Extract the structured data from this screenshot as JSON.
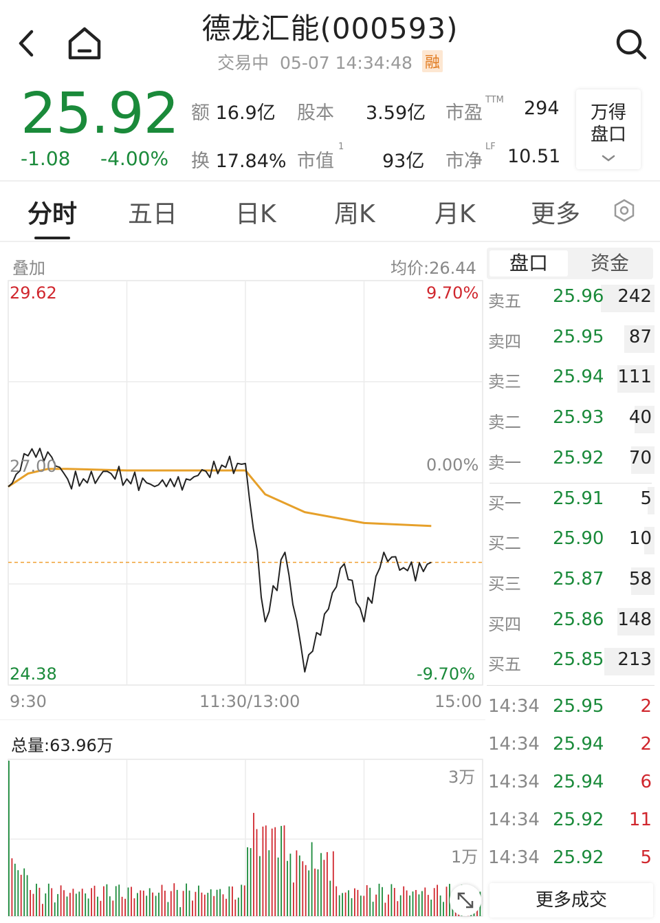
{
  "header": {
    "title": "德龙汇能(000593)",
    "status": "交易中",
    "datetime": "05-07 14:34:48",
    "badge": "融"
  },
  "quote": {
    "price": "25.92",
    "change": "-1.08",
    "change_pct": "-4.00%",
    "amount_label": "额",
    "amount": "16.9亿",
    "share_label": "股本",
    "share": "3.59亿",
    "pe_label": "市盈",
    "pe_sup": "TTM",
    "pe": "294",
    "turnover_label": "换",
    "turnover": "17.84%",
    "mcap_label": "市值",
    "mcap_sup": "1",
    "mcap": "93亿",
    "pb_label": "市净",
    "pb_sup": "LF",
    "pb": "10.51",
    "wind_line1": "万得",
    "wind_line2": "盘口"
  },
  "tabs": [
    "分时",
    "五日",
    "日K",
    "周K",
    "月K",
    "更多"
  ],
  "active_tab": "分时",
  "chart": {
    "overlay_label": "叠加",
    "avg_price_label": "均价:26.44",
    "y_high": "29.62",
    "y_mid": "27.00",
    "y_low": "24.38",
    "pct_high": "9.70%",
    "pct_mid": "0.00%",
    "pct_low": "-9.70%",
    "x_start": "9:30",
    "x_mid": "11:30/13:00",
    "x_end": "15:00",
    "volume_label": "总量:63.96万",
    "vol_tick_high": "3万",
    "vol_tick_low": "1万",
    "line_color": "#222222",
    "avg_color": "#e6a02a",
    "ref_line_color": "#f0a030"
  },
  "chart_data": {
    "type": "line",
    "title": "",
    "xlabel": "",
    "ylabel": "",
    "ylim": [
      24.38,
      29.62
    ],
    "prev_close": 27.0,
    "series": [
      {
        "name": "",
        "x": [
          "9:30",
          "9:40",
          "9:50",
          "10:00",
          "10:10",
          "10:20",
          "10:30",
          "10:40",
          "10:50",
          "11:00",
          "11:10",
          "11:20",
          "11:30",
          "13:10",
          "13:20",
          "13:30",
          "13:40",
          "13:50",
          "14:00",
          "14:10",
          "14:20",
          "14:30",
          "14:34"
        ],
        "values": [
          26.95,
          27.35,
          27.4,
          27.05,
          27.0,
          27.15,
          27.05,
          27.0,
          26.95,
          27.05,
          27.15,
          27.2,
          27.25,
          25.2,
          26.1,
          24.55,
          25.3,
          25.95,
          25.2,
          26.1,
          25.9,
          25.85,
          25.97
        ]
      },
      {
        "name": "",
        "x": [
          "9:30",
          "9:40",
          "9:50",
          "10:00",
          "10:30",
          "11:00",
          "11:30",
          "13:10",
          "13:30",
          "14:00",
          "14:34"
        ],
        "values": [
          26.95,
          27.12,
          27.18,
          27.18,
          27.16,
          27.16,
          27.16,
          26.85,
          26.62,
          26.48,
          26.44
        ]
      }
    ],
    "volume": {
      "unit": "万",
      "ticks": [
        1,
        3
      ]
    }
  },
  "order_book": {
    "tab_active": "盘口",
    "tab_other": "资金",
    "asks": [
      {
        "label": "卖五",
        "price": "25.96",
        "vol": "242",
        "bar": 0.32
      },
      {
        "label": "卖四",
        "price": "25.95",
        "vol": "87",
        "bar": 0.18
      },
      {
        "label": "卖三",
        "price": "25.94",
        "vol": "111",
        "bar": 0.22
      },
      {
        "label": "卖二",
        "price": "25.93",
        "vol": "40",
        "bar": 0.12
      },
      {
        "label": "卖一",
        "price": "25.92",
        "vol": "70",
        "bar": 0.14
      }
    ],
    "bids": [
      {
        "label": "买一",
        "price": "25.91",
        "vol": "5",
        "bar": 0.04
      },
      {
        "label": "买二",
        "price": "25.90",
        "vol": "10",
        "bar": 0.06
      },
      {
        "label": "买三",
        "price": "25.87",
        "vol": "58",
        "bar": 0.14
      },
      {
        "label": "买四",
        "price": "25.86",
        "vol": "148",
        "bar": 0.22
      },
      {
        "label": "买五",
        "price": "25.85",
        "vol": "213",
        "bar": 0.3
      }
    ],
    "trades": [
      {
        "time": "14:34",
        "price": "25.95",
        "vol": "2"
      },
      {
        "time": "14:34",
        "price": "25.94",
        "vol": "2"
      },
      {
        "time": "14:34",
        "price": "25.94",
        "vol": "6"
      },
      {
        "time": "14:34",
        "price": "25.92",
        "vol": "11"
      },
      {
        "time": "14:34",
        "price": "25.92",
        "vol": "5"
      }
    ],
    "more_label": "更多成交"
  }
}
